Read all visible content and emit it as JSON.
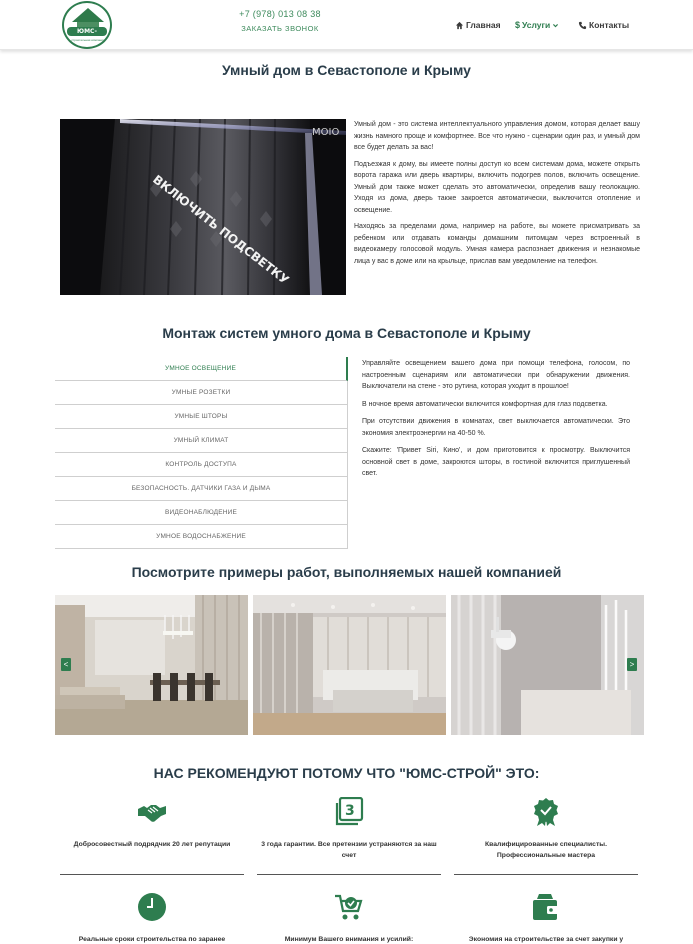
{
  "header": {
    "logo_text": "ЮМС-СТРОЙ",
    "logo_subtext": "строительная компания",
    "phone": "+7 (978) 013 08 38",
    "callback": "ЗАКАЗАТЬ ЗВОНОК",
    "nav": {
      "home": "Главная",
      "services": "Услуги",
      "contacts": "Контакты"
    }
  },
  "intro": {
    "title": "Умный дом в Севастополе и Крыму",
    "image_text": "ВКЛЮЧИТЬ ПОДСВЕТКУ",
    "image_brand": "MOIO",
    "paragraphs": [
      "Умный дом - это система интеллектуального управления домом, которая делает вашу жизнь намного проще и комфортнее. Все что нужно - сценарии один раз, и умный дом все будет делать за вас!",
      "Подъезжая к дому, вы имеете полны доступ ко всем системам дома, можете открыть ворота гаража или дверь квартиры, включить подогрев полов, включить освещение. Умный дом также может сделать это автоматически, определив вашу геолокацию. Уходя из дома, дверь также закроется автоматически, выключится отопление и освещение.",
      "Находясь за пределами дома, например на работе, вы можете присматривать за ребенком или отдавать команды домашним питомцам через встроенный в видеокамеру голосовой модуль. Умная камера распознает движения и незнакомые лица у вас в доме или на крыльце, прислав вам уведомление на телефон."
    ]
  },
  "install": {
    "title": "Монтаж систем умного дома в Севастополе и Крыму",
    "tabs": [
      "УМНОЕ ОСВЕЩЕНИЕ",
      "УМНЫЕ РОЗЕТКИ",
      "УМНЫЕ ШТОРЫ",
      "УМНЫЙ КЛИМАТ",
      "КОНТРОЛЬ ДОСТУПА",
      "БЕЗОПАСНОСТЬ. ДАТЧИКИ ГАЗА И ДЫМА",
      "ВИДЕОНАБЛЮДЕНИЕ",
      "УМНОЕ ВОДОСНАБЖЕНИЕ"
    ],
    "active_tab": 0,
    "paragraphs": [
      "Управляйте освещением вашего дома при помощи телефона, голосом, по настроенным сценариям или автоматически при обнаружении движения. Выключатели на стене - это рутина, которая уходит в прошлое!",
      "В ночное время автоматически включится комфортная для глаз подсветка.",
      "При отсутствии движения в комнатах, свет выключается автоматически. Это экономия электроэнергии на 40-50 %.",
      "Скажите: 'Привет Siri, Кино', и дом приготовится к просмотру. Выключится основной свет в доме, закроются шторы, в гостиной включится приглушенный свет."
    ]
  },
  "gallery": {
    "title": "Посмотрите примеры работ, выполняемых нашей компанией",
    "prev": "<",
    "next": ">"
  },
  "benefits": {
    "title": "НАС РЕКОМЕНДУЮТ ПОТОМУ ЧТО \"ЮМС-СТРОЙ\" ЭТО:",
    "items": [
      {
        "icon": "handshake-icon",
        "text": "Добросовестный подрядчик 20 лет репутации"
      },
      {
        "icon": "guarantee-3-icon",
        "text": "3 года гарантии. Все претензии устраняются за наш счет"
      },
      {
        "icon": "badge-check-icon",
        "text": "Квалифицированные специалисты. Профессиональные мастера"
      },
      {
        "icon": "clock-icon",
        "text": "Реальные сроки строительства по заранее"
      },
      {
        "icon": "cart-check-icon",
        "text": "Минимум Вашего внимания и усилий:"
      },
      {
        "icon": "wallet-icon",
        "text": "Экономия на строительстве за счет закупки у"
      }
    ]
  },
  "colors": {
    "accent": "#2e7d4f",
    "heading": "#2a3d4a"
  }
}
